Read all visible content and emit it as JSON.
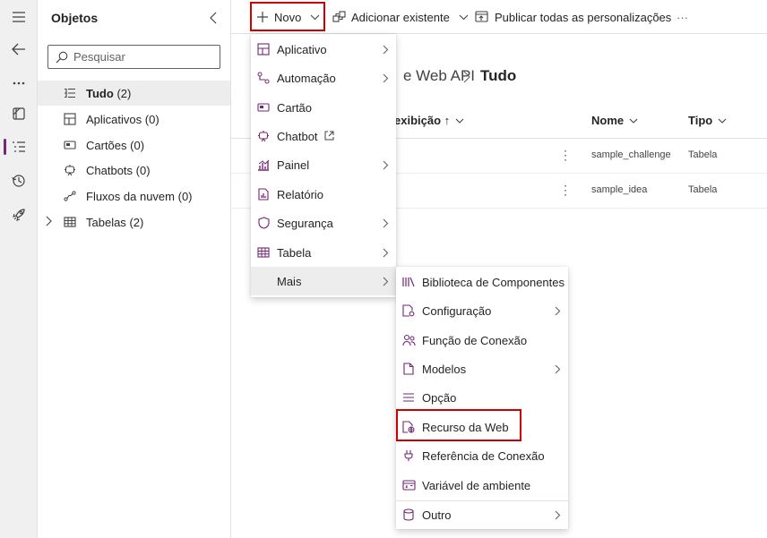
{
  "colors": {
    "accent": "#742774",
    "highlight_box": "#d00000",
    "selected_bg": "#ededed"
  },
  "rail": {
    "items": [
      {
        "name": "hamburger-icon"
      },
      {
        "name": "back-arrow-icon"
      },
      {
        "name": "more-icon"
      },
      {
        "name": "solutions-icon"
      },
      {
        "name": "objects-icon",
        "active": true
      },
      {
        "name": "history-icon"
      },
      {
        "name": "deployment-rocket-icon"
      }
    ]
  },
  "objects_panel": {
    "title": "Objetos",
    "search_placeholder": "Pesquisar",
    "items": [
      {
        "label": "Tudo",
        "count": "(2)",
        "icon": "list-icon",
        "selected": true
      },
      {
        "label": "Aplicativos",
        "count": "(0)",
        "icon": "apps-icon"
      },
      {
        "label": "Cartões",
        "count": "(0)",
        "icon": "card-icon"
      },
      {
        "label": "Chatbots",
        "count": "(0)",
        "icon": "chatbot-icon"
      },
      {
        "label": "Fluxos da nuvem",
        "count": "(0)",
        "icon": "flow-icon"
      },
      {
        "label": "Tabelas",
        "count": "(2)",
        "icon": "table-icon",
        "expandable": true
      }
    ]
  },
  "toolbar": {
    "new_label": "Novo",
    "add_existing_label": "Adicionar existente",
    "publish_label": "Publicar todas as personalizações",
    "more_label": "···"
  },
  "breadcrumb": {
    "parent": "e Web API",
    "current": "Tudo"
  },
  "table": {
    "columns": {
      "display_name": "exibição ↑",
      "name": "Nome",
      "type": "Tipo"
    },
    "rows": [
      {
        "name": "sample_challenge",
        "type": "Tabela",
        "more": "⋮"
      },
      {
        "name": "sample_idea",
        "type": "Tabela",
        "more": "⋮"
      }
    ]
  },
  "new_menu": {
    "items": [
      {
        "label": "Aplicativo",
        "icon": "app-icon",
        "submenu": true
      },
      {
        "label": "Automação",
        "icon": "automation-icon",
        "submenu": true
      },
      {
        "label": "Cartão",
        "icon": "card-icon",
        "submenu": false
      },
      {
        "label": "Chatbot",
        "icon": "chatbot-icon",
        "submenu": false,
        "external": true
      },
      {
        "label": "Painel",
        "icon": "dashboard-icon",
        "submenu": true
      },
      {
        "label": "Relatório",
        "icon": "report-icon",
        "submenu": false
      },
      {
        "label": "Segurança",
        "icon": "shield-icon",
        "submenu": true
      },
      {
        "label": "Tabela",
        "icon": "table-icon",
        "submenu": true
      },
      {
        "label": "Mais",
        "icon": "",
        "submenu": true,
        "hovered": true
      }
    ]
  },
  "more_menu": {
    "items": [
      {
        "label": "Biblioteca de Componentes",
        "icon": "library-icon",
        "submenu": false
      },
      {
        "label": "Configuração",
        "icon": "settings-doc-icon",
        "submenu": true
      },
      {
        "label": "Função de Conexão",
        "icon": "people-icon",
        "submenu": false
      },
      {
        "label": "Modelos",
        "icon": "document-icon",
        "submenu": true
      },
      {
        "label": "Opção",
        "icon": "option-list-icon",
        "submenu": false
      },
      {
        "label": "Recurso da Web",
        "icon": "web-resource-icon",
        "submenu": false,
        "highlighted": true
      },
      {
        "label": "Referência de Conexão",
        "icon": "plug-icon",
        "submenu": false
      },
      {
        "label": "Variável de ambiente",
        "icon": "variable-icon",
        "submenu": false
      },
      {
        "label": "Outro",
        "icon": "database-icon",
        "submenu": true
      }
    ]
  }
}
